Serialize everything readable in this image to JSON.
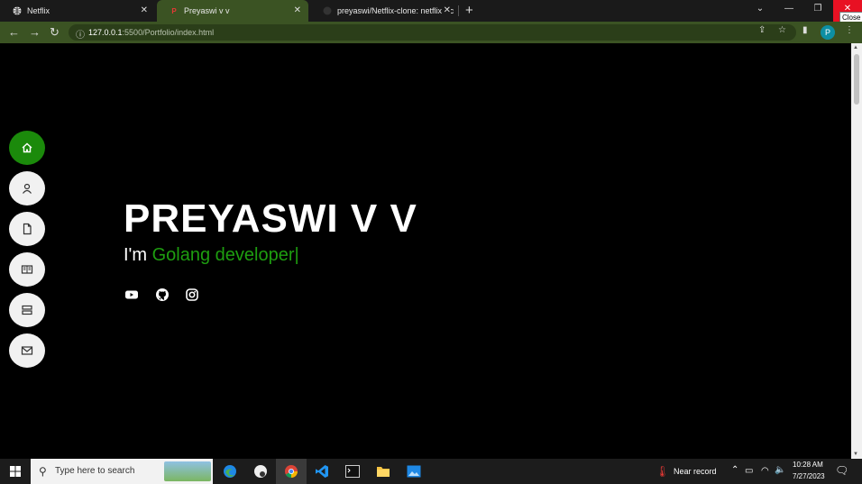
{
  "browser": {
    "tabs": [
      {
        "title": "Netflix",
        "active": false
      },
      {
        "title": "Preyaswi v v",
        "active": true
      },
      {
        "title": "preyaswi/Netflix-clone: netflix's c",
        "active": false
      }
    ],
    "new_tab_label": "+",
    "close_tooltip": "Close",
    "url": {
      "host": "127.0.0.1",
      "path": ":5500/Portfolio/index.html"
    },
    "profile_initial": "P"
  },
  "sidenav": {
    "items": [
      {
        "name": "home",
        "active": true
      },
      {
        "name": "about",
        "active": false
      },
      {
        "name": "resume",
        "active": false
      },
      {
        "name": "portfolio",
        "active": false
      },
      {
        "name": "services",
        "active": false
      },
      {
        "name": "contact",
        "active": false
      }
    ]
  },
  "hero": {
    "name": "PREYASWI V V",
    "prefix": "I'm ",
    "role": "Golang developer",
    "cursor": "|"
  },
  "social": [
    "youtube-icon",
    "github-icon",
    "instagram-icon"
  ],
  "taskbar": {
    "search_placeholder": "Type here to search",
    "weather": "Near record",
    "time": "10:28 AM",
    "date": "7/27/2023"
  },
  "colors": {
    "accent": "#1b8a0b",
    "browser_frame": "#3b5323"
  }
}
